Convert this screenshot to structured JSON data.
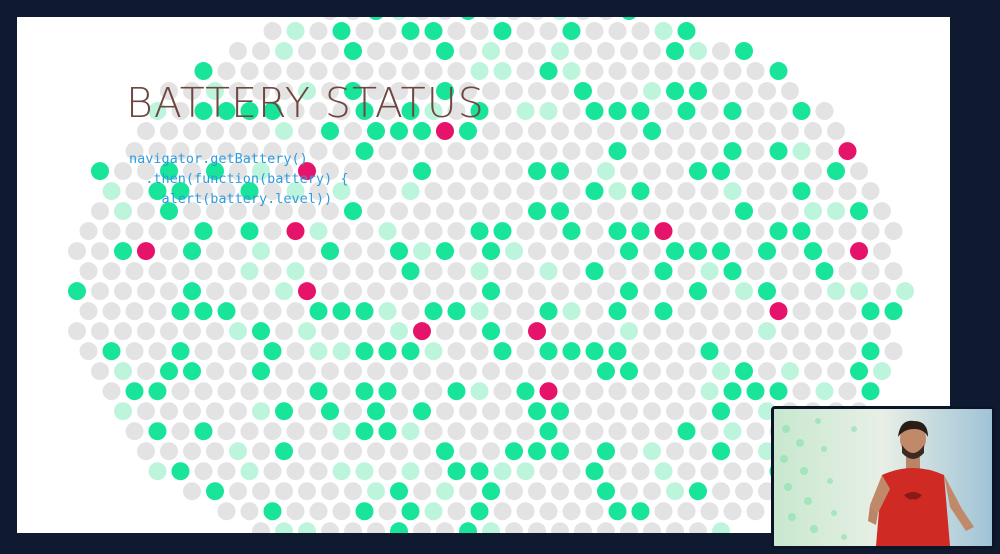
{
  "slide": {
    "title": "BATTERY STATUS",
    "code_lines": [
      "navigator.getBattery()",
      "  .then(function(battery) {",
      "    alert(battery.level))"
    ]
  },
  "colors": {
    "stage_background": "#0f1a30",
    "slide_background": "#ffffff",
    "title": "#6e4740",
    "code": "#2f9be0",
    "dot_grey": "#e3e3e3",
    "dot_green": "#18e59a",
    "dot_light_green": "#bdf5dc",
    "dot_pink": "#e6136b"
  },
  "video_inset": {
    "content": "presenter-webcam",
    "presenter_shirt_color": "#d02a24"
  }
}
